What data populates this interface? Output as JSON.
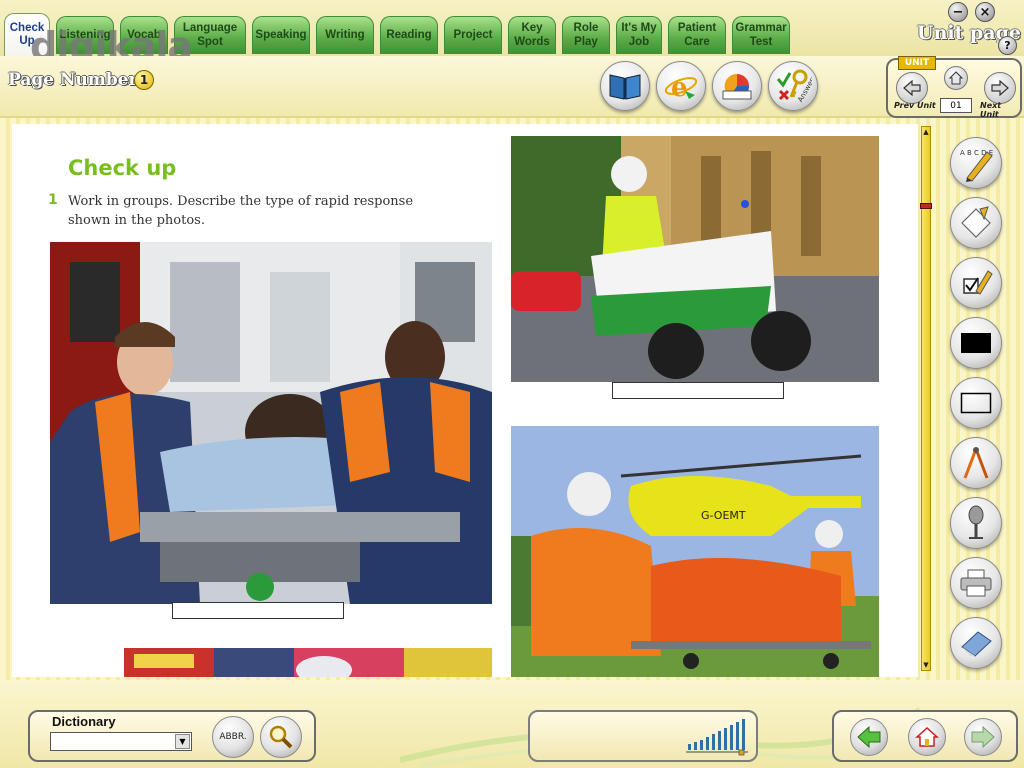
{
  "tabs": [
    {
      "label": "Check Up",
      "active": true
    },
    {
      "label": "Listening",
      "active": false
    },
    {
      "label": "Vocab",
      "active": false
    },
    {
      "label": "Language Spot",
      "active": false
    },
    {
      "label": "Speaking",
      "active": false
    },
    {
      "label": "Writing",
      "active": false
    },
    {
      "label": "Reading",
      "active": false
    },
    {
      "label": "Project",
      "active": false
    },
    {
      "label": "Key Words",
      "active": false
    },
    {
      "label": "Role Play",
      "active": false
    },
    {
      "label": "It's My Job",
      "active": false
    },
    {
      "label": "Patient Care",
      "active": false
    },
    {
      "label": "Grammar Test",
      "active": false
    }
  ],
  "watermark": "digikala",
  "window_controls": {
    "minimize": "−",
    "close": "×"
  },
  "header": {
    "unit_page_label": "Unit page",
    "help_label": "?",
    "page_number_label": "Page Number",
    "page_number_value": "1"
  },
  "toolbar_icons": [
    "book-icon",
    "internet-explorer-icon",
    "chart-icon",
    "answers-key-icon"
  ],
  "answers_label": "Answers",
  "unit_nav": {
    "tag": "UNIT",
    "prev_label": "Prev Unit",
    "next_label": "Next Unit",
    "unit_value": "01"
  },
  "content": {
    "section_title": "Check up",
    "exercise_number": "1",
    "exercise_text": "Work in groups. Describe the type of rapid response shown in the photos."
  },
  "photos": [
    {
      "name": "ambulance-paramedics-photo"
    },
    {
      "name": "motorcycle-paramedic-photo"
    },
    {
      "name": "air-ambulance-photo"
    }
  ],
  "side_tools": [
    {
      "name": "abc-pencil-tool",
      "label": "A B C D E F G H I"
    },
    {
      "name": "eraser-note-tool"
    },
    {
      "name": "checkbox-tool"
    },
    {
      "name": "filled-rectangle-tool"
    },
    {
      "name": "empty-rectangle-tool"
    },
    {
      "name": "compass-tool"
    },
    {
      "name": "microphone-tool"
    },
    {
      "name": "printer-tool"
    },
    {
      "name": "eraser-tool"
    }
  ],
  "dictionary": {
    "label": "Dictionary",
    "value": "",
    "abbr_label": "ABBR."
  },
  "colors": {
    "accent_green": "#78be20",
    "tab_green": "#5fae4b",
    "scroll_yellow": "#e8c924",
    "thumb_red": "#c0262b"
  }
}
